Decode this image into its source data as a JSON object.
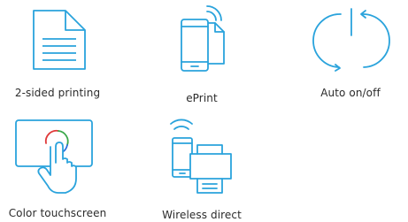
{
  "features": [
    {
      "label": "2-sided printing",
      "icon": "duplex-document-icon"
    },
    {
      "label": "ePrint",
      "icon": "eprint-mobile-icon"
    },
    {
      "label": "Auto on/off",
      "icon": "power-cycle-icon"
    },
    {
      "label": "Color touchscreen",
      "icon": "color-touchscreen-icon"
    },
    {
      "label": "Wireless direct",
      "icon": "wireless-direct-icon"
    }
  ],
  "colors": {
    "icon_blue": "#2aa3dc",
    "touch_red": "#e03a3a",
    "touch_green": "#3aa84a",
    "touch_blue": "#2a6fdc",
    "text": "#2b2b2b"
  }
}
